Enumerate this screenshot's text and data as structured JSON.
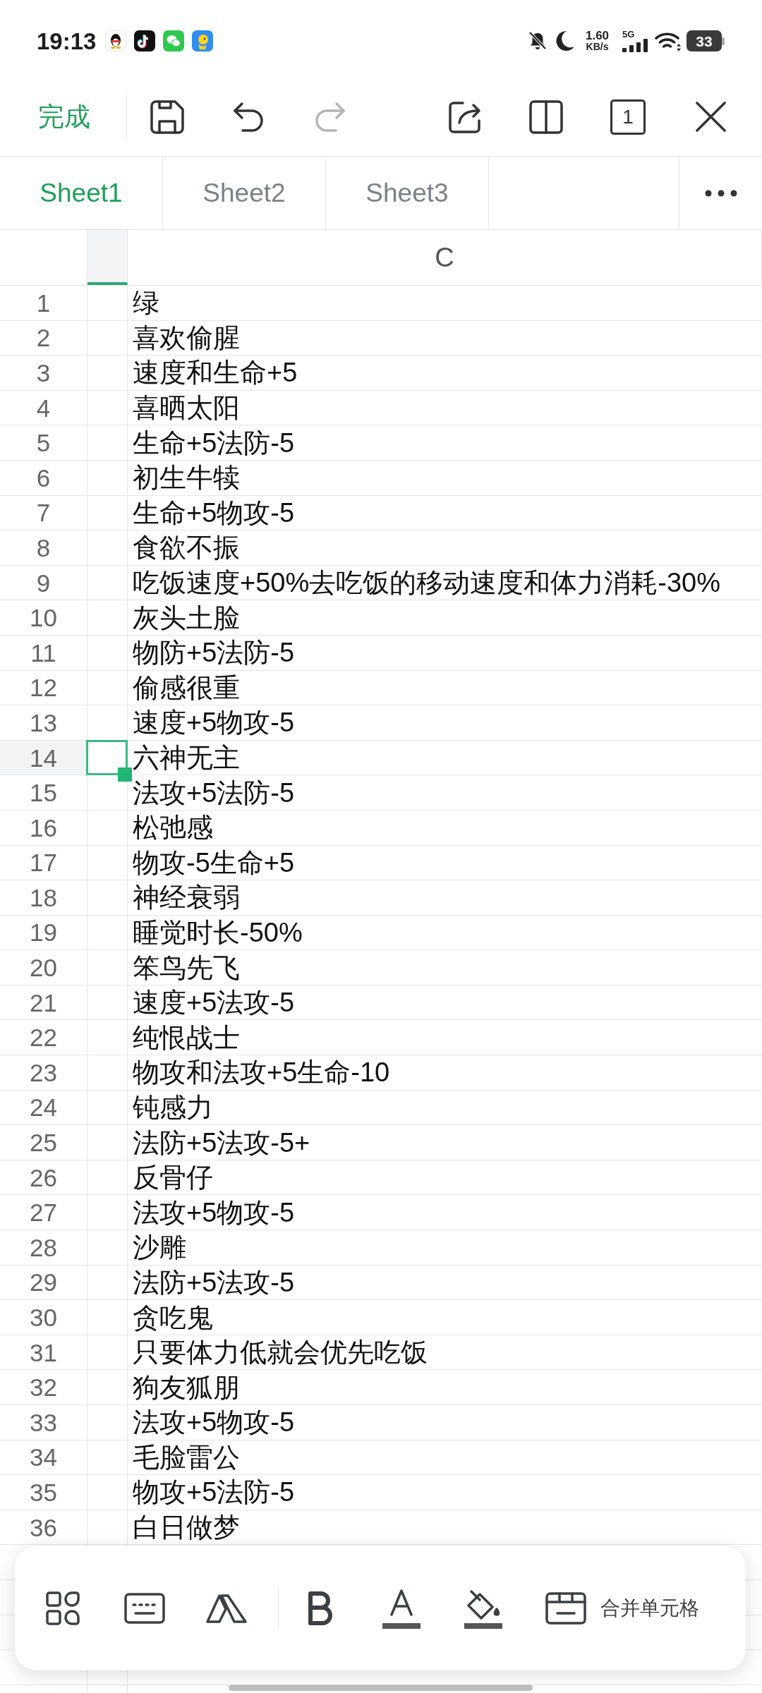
{
  "status_bar": {
    "time": "19:13",
    "network_speed": "1.60",
    "network_speed_unit": "KB/s",
    "network_type": "5G",
    "battery": "33"
  },
  "toolbar": {
    "done": "完成",
    "buttons": [
      {
        "kind": "save",
        "disabled": false
      },
      {
        "kind": "undo",
        "disabled": false
      },
      {
        "kind": "redo",
        "disabled": true
      },
      {
        "kind": "share",
        "disabled": false
      },
      {
        "kind": "split",
        "disabled": false
      },
      {
        "kind": "page",
        "label": "1",
        "disabled": false
      },
      {
        "kind": "close",
        "disabled": false
      }
    ]
  },
  "sheet_tabs": [
    {
      "label": "Sheet1",
      "selected": true
    },
    {
      "label": "Sheet2",
      "selected": false
    },
    {
      "label": "Sheet3",
      "selected": false
    }
  ],
  "grid": {
    "columns": [
      {
        "selected": true
      },
      {
        "label": "C",
        "selected": false
      }
    ],
    "rows": [
      {
        "number": "1",
        "cell": "绿",
        "selected": false
      },
      {
        "number": "2",
        "cell": "喜欢偷腥",
        "selected": false
      },
      {
        "number": "3",
        "cell": "速度和生命+5",
        "selected": false
      },
      {
        "number": "4",
        "cell": "喜晒太阳",
        "selected": false
      },
      {
        "number": "5",
        "cell": "生命+5法防-5",
        "selected": false
      },
      {
        "number": "6",
        "cell": "初生牛犊",
        "selected": false
      },
      {
        "number": "7",
        "cell": "生命+5物攻-5",
        "selected": false
      },
      {
        "number": "8",
        "cell": "食欲不振",
        "selected": false
      },
      {
        "number": "9",
        "cell": "吃饭速度+50%去吃饭的移动速度和体力消耗-30%",
        "selected": false
      },
      {
        "number": "10",
        "cell": "灰头土脸",
        "selected": false
      },
      {
        "number": "11",
        "cell": "物防+5法防-5",
        "selected": false
      },
      {
        "number": "12",
        "cell": "偷感很重",
        "selected": false
      },
      {
        "number": "13",
        "cell": "速度+5物攻-5",
        "selected": false
      },
      {
        "number": "14",
        "cell": "六神无主",
        "selected": true
      },
      {
        "number": "15",
        "cell": "法攻+5法防-5",
        "selected": false
      },
      {
        "number": "16",
        "cell": "松弛感",
        "selected": false
      },
      {
        "number": "17",
        "cell": "物攻-5生命+5",
        "selected": false
      },
      {
        "number": "18",
        "cell": "神经衰弱",
        "selected": false
      },
      {
        "number": "19",
        "cell": "睡觉时长-50%",
        "selected": false
      },
      {
        "number": "20",
        "cell": "笨鸟先飞",
        "selected": false
      },
      {
        "number": "21",
        "cell": "速度+5法攻-5",
        "selected": false
      },
      {
        "number": "22",
        "cell": "纯恨战士",
        "selected": false
      },
      {
        "number": "23",
        "cell": "物攻和法攻+5生命-10",
        "selected": false
      },
      {
        "number": "24",
        "cell": "钝感力",
        "selected": false
      },
      {
        "number": "25",
        "cell": "法防+5法攻-5+",
        "selected": false
      },
      {
        "number": "26",
        "cell": "反骨仔",
        "selected": false
      },
      {
        "number": "27",
        "cell": "法攻+5物攻-5",
        "selected": false
      },
      {
        "number": "28",
        "cell": "沙雕",
        "selected": false
      },
      {
        "number": "29",
        "cell": "法防+5法攻-5",
        "selected": false
      },
      {
        "number": "30",
        "cell": "贪吃鬼",
        "selected": false
      },
      {
        "number": "31",
        "cell": "只要体力低就会优先吃饭",
        "selected": false
      },
      {
        "number": "32",
        "cell": "狗友狐朋",
        "selected": false
      },
      {
        "number": "33",
        "cell": "法攻+5物攻-5",
        "selected": false
      },
      {
        "number": "34",
        "cell": "毛脸雷公",
        "selected": false
      },
      {
        "number": "35",
        "cell": "物攻+5法防-5",
        "selected": false
      },
      {
        "number": "36",
        "cell": "白日做梦",
        "selected": false
      }
    ]
  },
  "format_toolbar": {
    "groups": [
      {
        "buttons": [
          {
            "kind": "layout"
          },
          {
            "kind": "keyboard"
          },
          {
            "kind": "cell_style"
          }
        ]
      },
      {
        "buttons": [
          {
            "kind": "bold"
          },
          {
            "kind": "font_color"
          },
          {
            "kind": "fill_color"
          },
          {
            "kind": "merge",
            "label": "合并单元格"
          }
        ]
      }
    ]
  }
}
